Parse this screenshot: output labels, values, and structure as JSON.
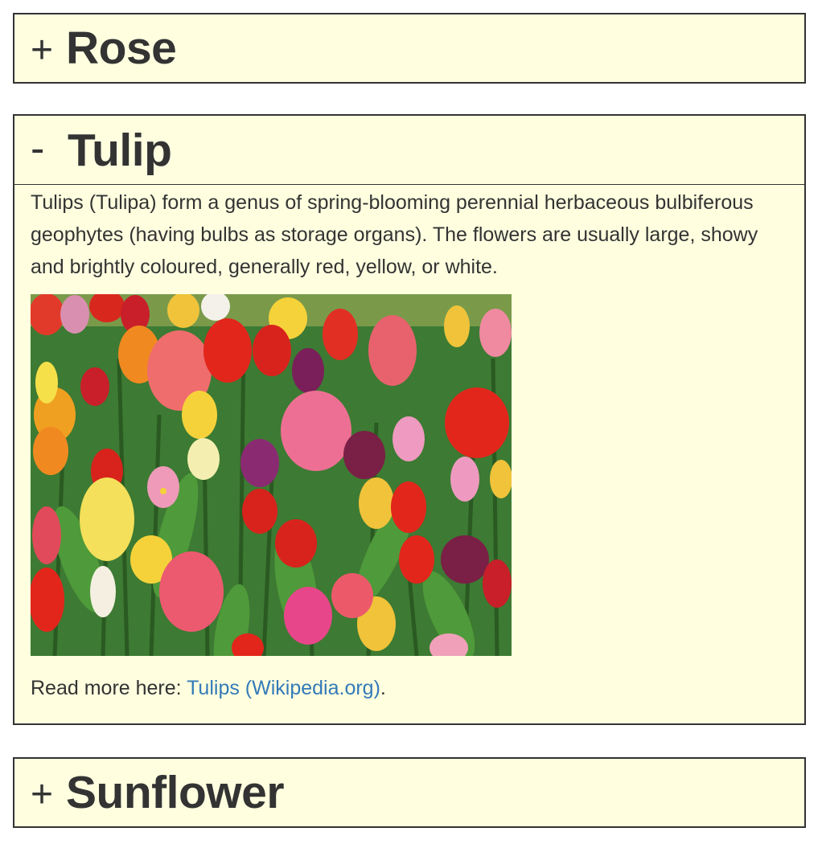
{
  "accordion": {
    "panels": [
      {
        "toggle": "+",
        "title": "Rose",
        "expanded": false
      },
      {
        "toggle": "-",
        "title": "Tulip",
        "expanded": true,
        "description": "Tulips (Tulipa) form a genus of spring-blooming perennial herbaceous bulbiferous geophytes (having bulbs as storage organs). The flowers are usually large, showy and brightly coloured, generally red, yellow, or white.",
        "read_more_prefix": "Read more here: ",
        "read_more_link": "Tulips (Wikipedia.org)",
        "read_more_suffix": "."
      },
      {
        "toggle": "+",
        "title": "Sunflower",
        "expanded": false
      }
    ]
  },
  "colors": {
    "panel_background": "#ffffe0",
    "panel_border": "#333333",
    "text": "#333333",
    "link": "#337ab7"
  }
}
